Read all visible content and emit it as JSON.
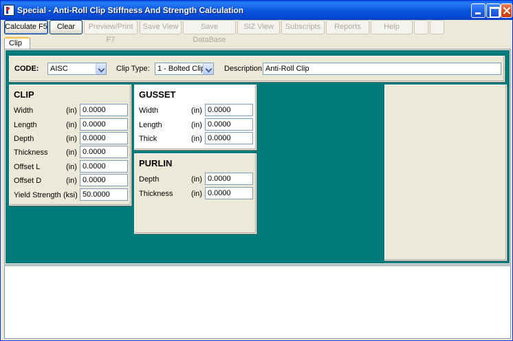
{
  "window": {
    "title": "Special - Anti-Roll Clip Stiffness And Strength Calculation"
  },
  "toolbar": {
    "buttons": [
      {
        "label": "Calculate F5"
      },
      {
        "label": "Clear"
      },
      {
        "label": "Preview/Print F7"
      },
      {
        "label": "Save View"
      },
      {
        "label": "Save DataBase"
      },
      {
        "label": "SIZ View"
      },
      {
        "label": "Subscripts"
      },
      {
        "label": "Reports"
      },
      {
        "label": "Help"
      },
      {
        "label": ""
      },
      {
        "label": ""
      }
    ]
  },
  "tabs": [
    {
      "label": "Clip"
    }
  ],
  "header": {
    "code_label": "CODE:",
    "code_value": "AISC",
    "clip_type_label": "Clip Type:",
    "clip_type_value": "1 - Bolted Clip",
    "description_label": "Description:",
    "description_value": "Anti-Roll Clip"
  },
  "clip": {
    "title": "CLIP",
    "fields": [
      {
        "label": "Width",
        "unit": "(in)",
        "value": "0.0000"
      },
      {
        "label": "Length",
        "unit": "(in)",
        "value": "0.0000"
      },
      {
        "label": "Depth",
        "unit": "(in)",
        "value": "0.0000"
      },
      {
        "label": "Thickness",
        "unit": "(in)",
        "value": "0.0000"
      },
      {
        "label": "Offset L",
        "unit": "(in)",
        "value": "0.0000"
      },
      {
        "label": "Offset D",
        "unit": "(in)",
        "value": "0.0000"
      },
      {
        "label": "Yield Strength",
        "unit": "(ksi)",
        "value": "50.0000"
      }
    ]
  },
  "gusset": {
    "title": "GUSSET",
    "fields": [
      {
        "label": "Width",
        "unit": "(in)",
        "value": "0.0000"
      },
      {
        "label": "Length",
        "unit": "(in)",
        "value": "0.0000"
      },
      {
        "label": "Thick",
        "unit": "(in)",
        "value": "0.0000"
      }
    ]
  },
  "purlin": {
    "title": "PURLIN",
    "fields": [
      {
        "label": "Depth",
        "unit": "(in)",
        "value": "0.0000"
      },
      {
        "label": "Thickness",
        "unit": "(in)",
        "value": "0.0000"
      }
    ]
  },
  "colors": {
    "titlebar": "#0a56de",
    "panel_background": "#007b7b",
    "dialog_face": "#ece9d8"
  }
}
